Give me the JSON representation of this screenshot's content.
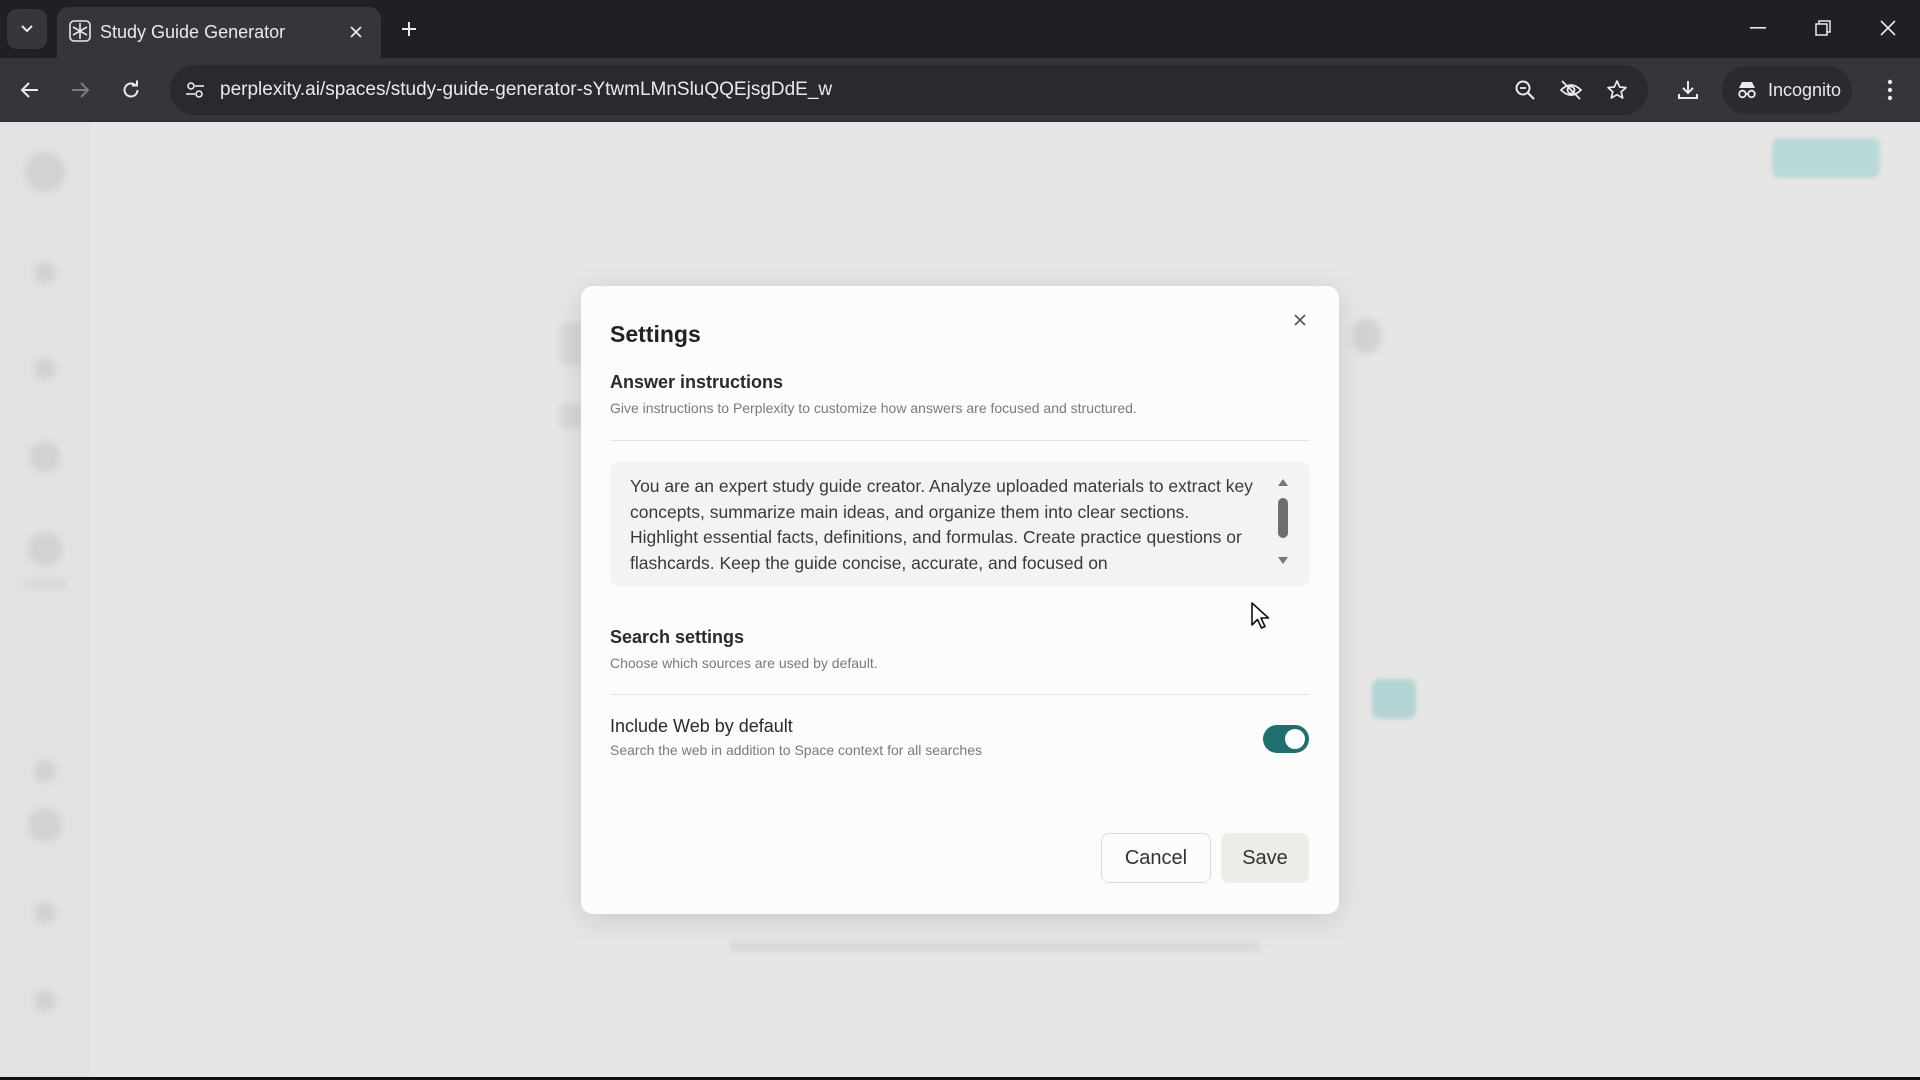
{
  "browser": {
    "tab_title": "Study Guide Generator",
    "url": "perplexity.ai/spaces/study-guide-generator-sYtwmLMnSluQQEjsgDdE_w",
    "incognito_label": "Incognito"
  },
  "modal": {
    "title": "Settings",
    "answer_instructions": {
      "title": "Answer instructions",
      "description": "Give instructions to Perplexity to customize how answers are focused and structured.",
      "text": "You are an expert study guide creator. Analyze uploaded materials to extract key concepts, summarize main ideas, and organize them into clear sections. Highlight essential facts, definitions, and formulas. Create practice questions or flashcards. Keep the guide concise, accurate, and focused on"
    },
    "search_settings": {
      "title": "Search settings",
      "description": "Choose which sources are used by default."
    },
    "include_web": {
      "title": "Include Web by default",
      "description": "Search the web in addition to Space context for all searches",
      "enabled": true
    },
    "cancel_label": "Cancel",
    "save_label": "Save"
  },
  "colors": {
    "toggle_on": "#1f6f6d",
    "chrome_dark": "#1f2023",
    "toolbar": "#35363a"
  }
}
